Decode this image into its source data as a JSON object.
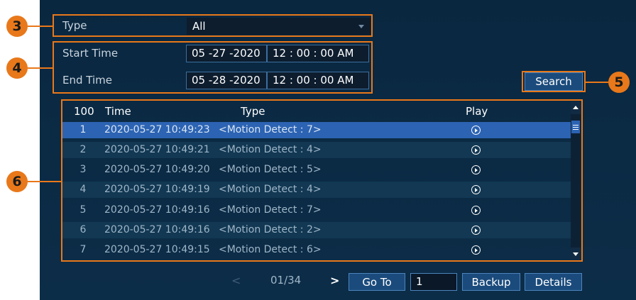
{
  "badges": {
    "b3": "3",
    "b4": "4",
    "b5": "5",
    "b6": "6"
  },
  "filter": {
    "type_label": "Type",
    "type_value": "All",
    "start_label": "Start Time",
    "start_date": "05 -27 -2020",
    "start_time": "12 : 00 : 00 AM",
    "end_label": "End Time",
    "end_date": "05 -28 -2020",
    "end_time": "12 : 00 : 00 AM",
    "search_label": "Search"
  },
  "table": {
    "headers": {
      "count": "100",
      "time": "Time",
      "type": "Type",
      "play": "Play"
    },
    "rows": [
      {
        "index": "1",
        "time": "2020-05-27 10:49:23",
        "type": "<Motion Detect : 7>",
        "selected": true
      },
      {
        "index": "2",
        "time": "2020-05-27 10:49:21",
        "type": "<Motion Detect : 4>"
      },
      {
        "index": "3",
        "time": "2020-05-27 10:49:20",
        "type": "<Motion Detect : 5>"
      },
      {
        "index": "4",
        "time": "2020-05-27 10:49:19",
        "type": "<Motion Detect : 4>"
      },
      {
        "index": "5",
        "time": "2020-05-27 10:49:16",
        "type": "<Motion Detect : 7>"
      },
      {
        "index": "6",
        "time": "2020-05-27 10:49:16",
        "type": "<Motion Detect : 2>"
      },
      {
        "index": "7",
        "time": "2020-05-27 10:49:15",
        "type": "<Motion Detect : 6>"
      }
    ]
  },
  "pager": {
    "prev": "<",
    "page": "01/34",
    "next": ">",
    "goto_label": "Go To",
    "goto_value": "1",
    "backup_label": "Backup",
    "details_label": "Details"
  },
  "colors": {
    "accent": "#e8781a",
    "selected_row": "#2c63b3",
    "panel": "#0c2d48"
  }
}
